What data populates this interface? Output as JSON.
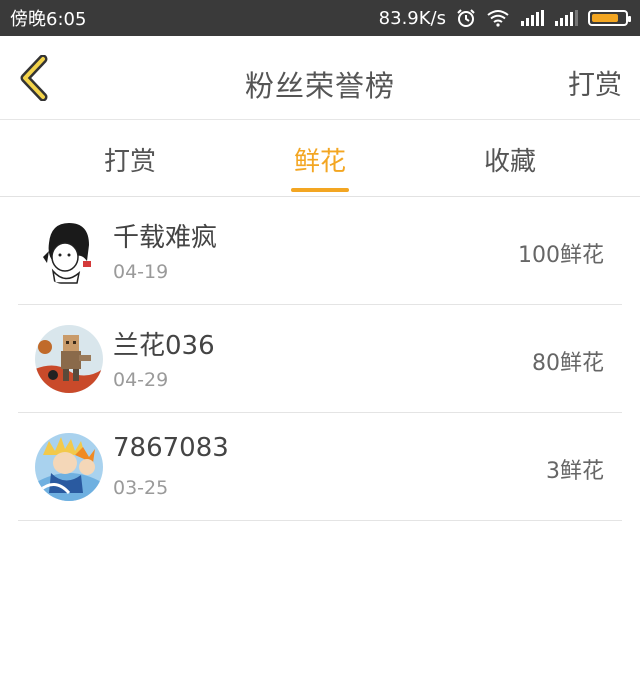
{
  "status_bar": {
    "carrier_time": "傍晚6:05",
    "net_speed": "83.9K/s",
    "battery_level": 0.8,
    "icons": [
      "alarm-icon",
      "wifi-icon",
      "signal-icon",
      "signal-icon",
      "battery-icon"
    ]
  },
  "header": {
    "title": "粉丝荣誉榜",
    "right_action": "打赏",
    "back_icon": "chevron-left-icon",
    "accent_color": "#f3a622"
  },
  "tabs": [
    {
      "label": "打赏",
      "active": false
    },
    {
      "label": "鲜花",
      "active": true
    },
    {
      "label": "收藏",
      "active": false
    }
  ],
  "fans": [
    {
      "name": "千载难疯",
      "date": "04-19",
      "amount": "100鲜花",
      "avatar": "sketch-avatar"
    },
    {
      "name": "兰花036",
      "date": "04-29",
      "amount": "80鲜花",
      "avatar": "blocky-character-avatar"
    },
    {
      "name": "7867083",
      "date": "03-25",
      "amount": "3鲜花",
      "avatar": "anime-avatar"
    }
  ]
}
